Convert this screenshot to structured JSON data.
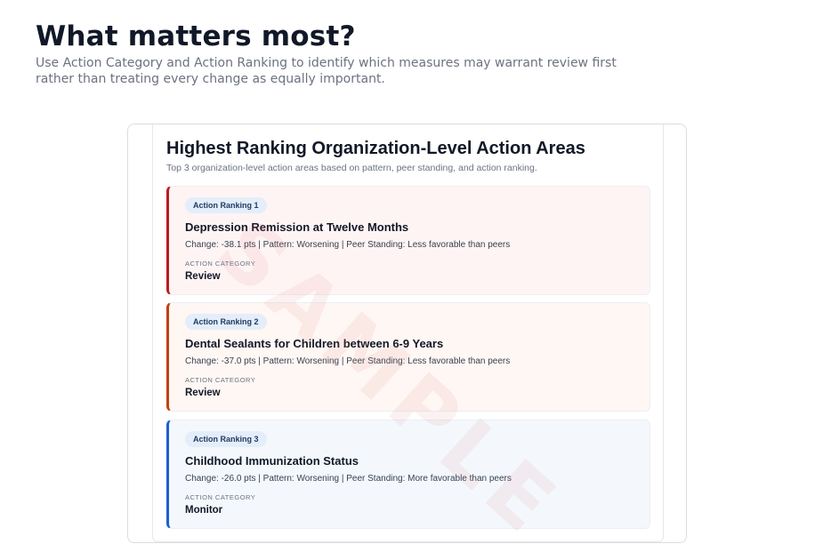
{
  "header": {
    "title": "What matters most?",
    "subtitle": "Use Action Category and Action Ranking to identify which measures may warrant review first rather than treating every change as equally important."
  },
  "panel": {
    "title": "Highest Ranking Organization-Level Action Areas",
    "subtitle": "Top 3 organization-level action areas based on pattern, peer standing, and action ranking.",
    "watermark": "SAMPLE",
    "cards": [
      {
        "rank_label": "Action Ranking 1",
        "measure": "Depression Remission at Twelve Months",
        "detail": "Change: -38.1 pts | Pattern: Worsening | Peer Standing: Less favorable than peers",
        "category_label": "ACTION CATEGORY",
        "category_value": "Review",
        "accent_color": "#b91c1c"
      },
      {
        "rank_label": "Action Ranking 2",
        "measure": "Dental Sealants for Children between 6-9 Years",
        "detail": "Change: -37.0 pts | Pattern: Worsening | Peer Standing: Less favorable than peers",
        "category_label": "ACTION CATEGORY",
        "category_value": "Review",
        "accent_color": "#c2410c"
      },
      {
        "rank_label": "Action Ranking 3",
        "measure": "Childhood Immunization Status",
        "detail": "Change: -26.0 pts | Pattern: Worsening | Peer Standing: More favorable than peers",
        "category_label": "ACTION CATEGORY",
        "category_value": "Monitor",
        "accent_color": "#1d5fd1"
      }
    ]
  }
}
